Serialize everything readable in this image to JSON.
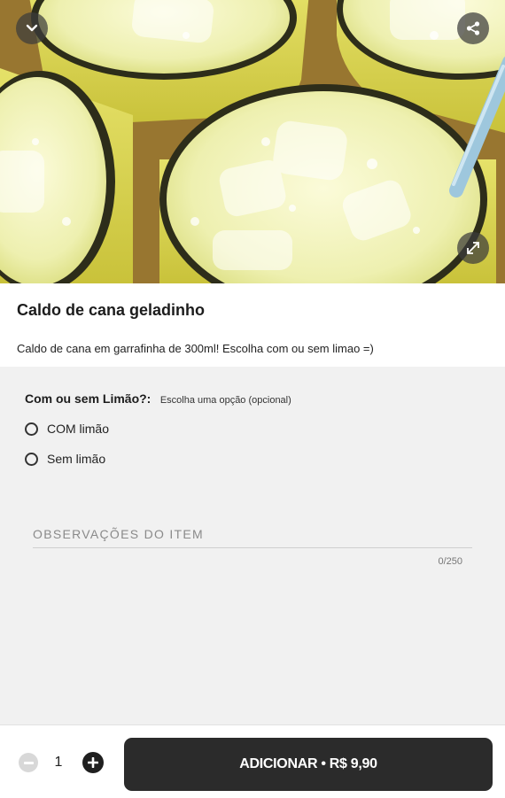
{
  "product": {
    "title": "Caldo de cana geladinho",
    "description": "Caldo de cana em garrafinha de 300ml! Escolha com ou sem limao =)"
  },
  "hero": {
    "icons": {
      "back": "chevron-down-icon",
      "share": "share-icon",
      "expand": "expand-icon"
    }
  },
  "option_group": {
    "title": "Com ou sem Limão?:",
    "hint": "Escolha uma opção (opcional)",
    "options": [
      {
        "label": "COM limão",
        "selected": false
      },
      {
        "label": "Sem limão",
        "selected": false
      }
    ]
  },
  "notes": {
    "placeholder": "OBSERVAÇÕES DO ITEM",
    "value": "",
    "counter": "0/250"
  },
  "footer": {
    "quantity": "1",
    "add_button_label": "ADICIONAR • R$ 9,90"
  },
  "colors": {
    "button_dark": "#2b2b2b",
    "panel_bg": "#f1f1f1",
    "drink": "#f3f3b8"
  }
}
